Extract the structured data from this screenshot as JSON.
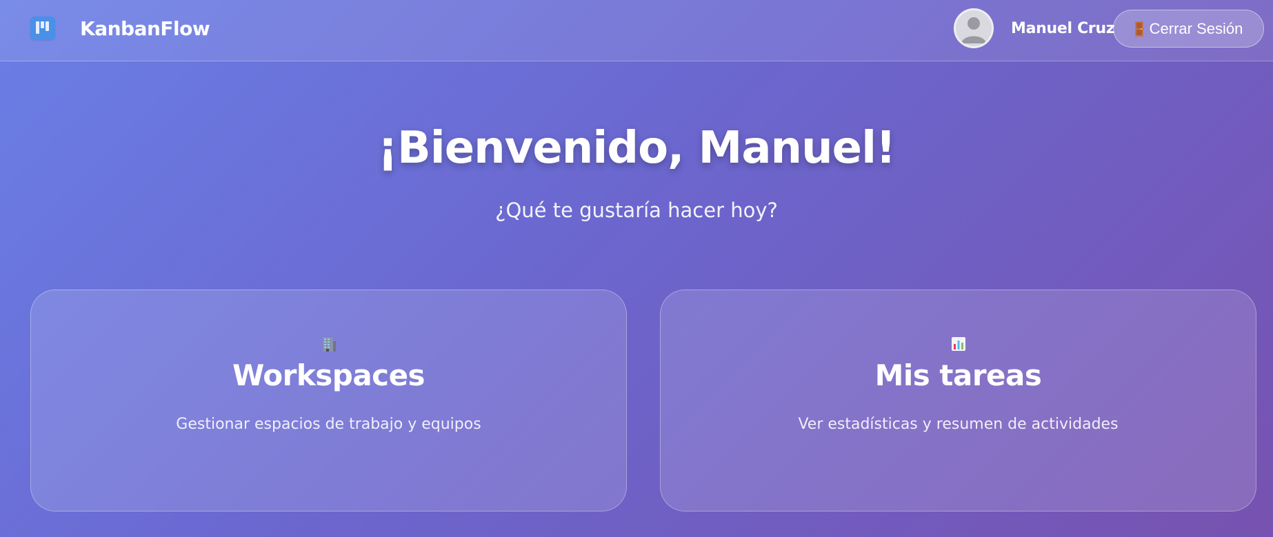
{
  "header": {
    "brand": "KanbanFlow",
    "user_name": "Manuel Cruz",
    "logout_label": "Cerrar Sesión",
    "logo_icon": "kanban-board-icon",
    "avatar_icon": "user-avatar-icon",
    "logout_icon": "door-icon"
  },
  "hero": {
    "title": "¡Bienvenido, Manuel!",
    "subtitle": "¿Qué te gustaría hacer hoy?"
  },
  "cards": [
    {
      "icon": "office-building-icon",
      "title": "Workspaces",
      "description": "Gestionar espacios de trabajo y equipos"
    },
    {
      "icon": "bar-chart-icon",
      "title": "Mis tareas",
      "description": "Ver estadísticas y resumen de actividades"
    }
  ],
  "colors": {
    "background_start": "#6a7fe6",
    "background_end": "#7752b0",
    "logo_blue": "#4a90e8"
  }
}
